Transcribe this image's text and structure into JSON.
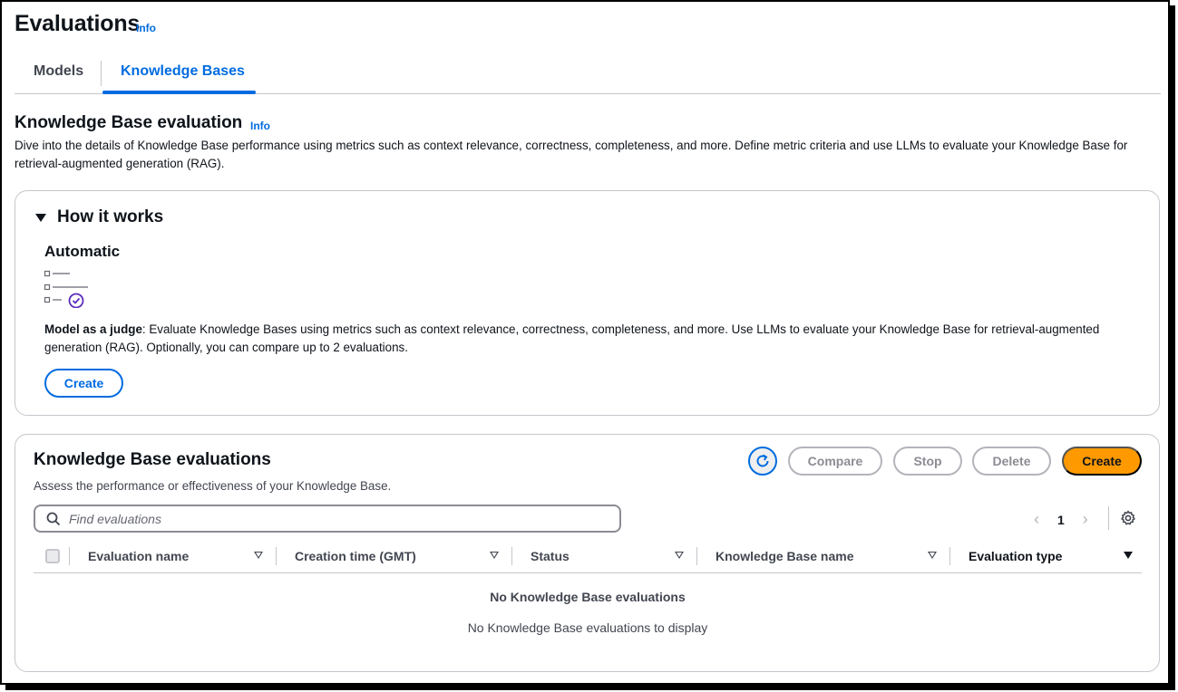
{
  "page": {
    "title": "Evaluations",
    "info_label": "Info"
  },
  "tabs": [
    {
      "label": "Models",
      "active": false
    },
    {
      "label": "Knowledge Bases",
      "active": true
    }
  ],
  "section": {
    "title": "Knowledge Base evaluation",
    "info_label": "Info",
    "description": "Dive into the details of Knowledge Base performance using metrics such as context relevance, correctness, completeness, and more. Define metric criteria and use LLMs to evaluate your Knowledge Base for retrieval-augmented generation (RAG)."
  },
  "how_it_works": {
    "header": "How it works",
    "expanded": true,
    "method_title": "Automatic",
    "method_icon": "checklist-check-icon",
    "judge_label": "Model as a judge",
    "judge_text": ": Evaluate Knowledge Bases using metrics such as context relevance, correctness, completeness, and more. Use LLMs to evaluate your Knowledge Base for retrieval-augmented generation (RAG). Optionally, you can compare up to 2 evaluations.",
    "create_label": "Create"
  },
  "evaluations": {
    "title": "Knowledge Base evaluations",
    "description": "Assess the performance or effectiveness of your Knowledge Base.",
    "actions": {
      "refresh_icon": "refresh-icon",
      "compare_label": "Compare",
      "stop_label": "Stop",
      "delete_label": "Delete",
      "create_label": "Create"
    },
    "search": {
      "placeholder": "Find evaluations",
      "value": ""
    },
    "pagination": {
      "current_page": "1"
    },
    "columns": [
      "Evaluation name",
      "Creation time (GMT)",
      "Status",
      "Knowledge Base name",
      "Evaluation type"
    ],
    "rows": [],
    "empty_title": "No Knowledge Base evaluations",
    "empty_message": "No Knowledge Base evaluations to display"
  },
  "colors": {
    "link_blue": "#006ce0",
    "primary_orange": "#ff9900",
    "border_gray": "#c6c6cd",
    "text_dark": "#0f141a"
  }
}
